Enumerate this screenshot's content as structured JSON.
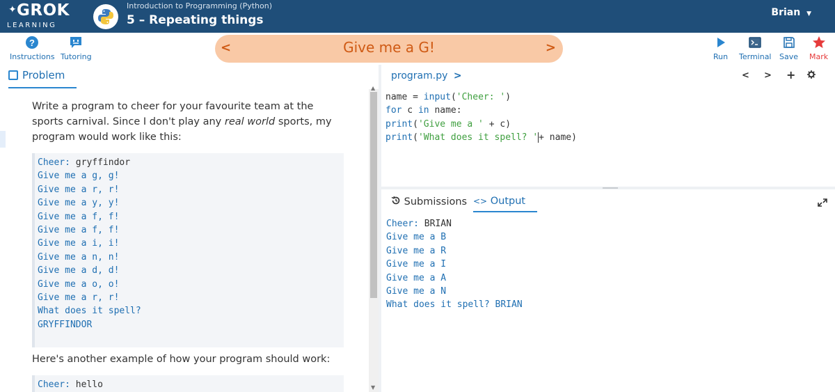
{
  "header": {
    "logo_top": "GROK",
    "logo_bottom": "LEARNING",
    "course": "Introduction to Programming (Python)",
    "lesson": "5 – Repeating things",
    "user": "Brian"
  },
  "toolbar": {
    "instructions": "Instructions",
    "tutoring": "Tutoring",
    "title": "Give me a G!",
    "prev": "<",
    "next": ">",
    "run": "Run",
    "terminal": "Terminal",
    "save": "Save",
    "mark": "Mark"
  },
  "problem": {
    "tab": "Problem",
    "desc_start": "Write a program to cheer for your favourite team at the sports carnival. Since I don't play any ",
    "desc_em": "real world",
    "desc_end": " sports, my program would work like this:",
    "example1": [
      {
        "prompt": "Cheer: ",
        "input": "gryffindor"
      },
      {
        "prompt": "Give me a g, g!"
      },
      {
        "prompt": "Give me a r, r!"
      },
      {
        "prompt": "Give me a y, y!"
      },
      {
        "prompt": "Give me a f, f!"
      },
      {
        "prompt": "Give me a f, f!"
      },
      {
        "prompt": "Give me a i, i!"
      },
      {
        "prompt": "Give me a n, n!"
      },
      {
        "prompt": "Give me a d, d!"
      },
      {
        "prompt": "Give me a o, o!"
      },
      {
        "prompt": "Give me a r, r!"
      },
      {
        "prompt": "What does it spell?"
      },
      {
        "prompt": "GRYFFINDOR"
      }
    ],
    "desc2": "Here's another example of how your program should work:",
    "example2_prompt": "Cheer: ",
    "example2_input": "hello"
  },
  "editor": {
    "filename": "program.py",
    "filename_arrow": ">",
    "ctl_prev": "<",
    "ctl_next": ">",
    "ctl_add": "+",
    "line1": {
      "a": "name = ",
      "b": "input",
      "c": "(",
      "d": "'Cheer: '",
      "e": ")"
    },
    "line2": {
      "a": "for",
      "b": " c ",
      "c": "in",
      "d": " name:"
    },
    "line3": {
      "a": "  print",
      "b": "(",
      "c": "'Give me a '",
      "d": " + c)"
    },
    "line4": {
      "a": "print",
      "b": "(",
      "c": "'What does it spell? '",
      "d": "+ name)"
    }
  },
  "output": {
    "tab_submissions": "Submissions",
    "tab_output": "Output",
    "cheer_prompt": "Cheer: ",
    "cheer_input": "BRIAN",
    "lines": [
      "Give me a B",
      "Give me a R",
      "Give me a I",
      "Give me a A",
      "Give me a N",
      "What does it spell? BRIAN"
    ]
  },
  "colors": {
    "header_bg": "#1f4e79",
    "accent_blue": "#1f6fb2",
    "banner_bg": "#f9c9a6",
    "banner_text": "#cf5a14",
    "string_green": "#3f9f3f",
    "mark_red": "#e63b3b"
  },
  "icons": [
    "python-logo-icon",
    "question-icon",
    "chat-icon",
    "play-icon",
    "terminal-icon",
    "save-icon",
    "star-icon",
    "document-icon",
    "history-icon",
    "code-icon",
    "expand-icon",
    "gear-icon"
  ]
}
